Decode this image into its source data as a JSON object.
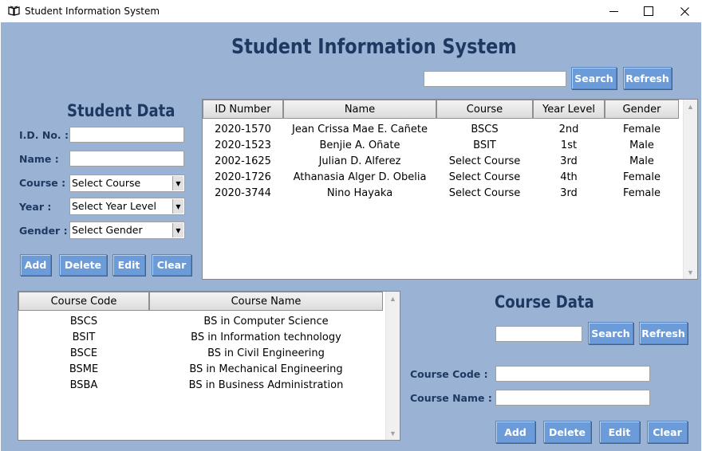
{
  "window": {
    "title": "Student Information System",
    "icon": "book-icon",
    "controls": {
      "minimize": "—",
      "maximize": "☐",
      "close": "✕"
    }
  },
  "header": {
    "title": "Student  Information  System"
  },
  "top_search": {
    "value": "",
    "search_label": "Search",
    "refresh_label": "Refresh"
  },
  "student_form": {
    "heading": "Student Data",
    "id_label": "I.D. No. :",
    "name_label": "Name :",
    "course_label": "Course :",
    "year_label": "Year :",
    "gender_label": "Gender :",
    "id_value": "",
    "name_value": "",
    "course_value": "Select Course",
    "year_value": "Select Year Level",
    "gender_value": "Select Gender",
    "buttons": {
      "add": "Add",
      "delete": "Delete",
      "edit": "Edit",
      "clear": "Clear"
    }
  },
  "student_table": {
    "columns": [
      "ID Number",
      "Name",
      "Course",
      "Year Level",
      "Gender"
    ],
    "rows": [
      [
        "2020-1570",
        "Jean Crissa Mae E. Cañete",
        "BSCS",
        "2nd",
        "Female"
      ],
      [
        "2020-1523",
        "Benjie A. Oñate",
        "BSIT",
        "1st",
        "Male"
      ],
      [
        "2002-1625",
        "Julian D. Alferez",
        "Select Course",
        "3rd",
        "Male"
      ],
      [
        "2020-1726",
        "Athanasia Alger D. Obelia",
        "Select Course",
        "4th",
        "Female"
      ],
      [
        "2020-3744",
        "Nino Hayaka",
        "Select Course",
        "3rd",
        "Female"
      ]
    ]
  },
  "course_table": {
    "columns": [
      "Course Code",
      "Course Name"
    ],
    "rows": [
      [
        "BSCS",
        "BS in Computer Science"
      ],
      [
        "BSIT",
        "BS in Information technology"
      ],
      [
        "BSCE",
        "BS in Civil Engineering"
      ],
      [
        "BSME",
        "BS in Mechanical Engineering"
      ],
      [
        "BSBA",
        "BS in Business Administration"
      ]
    ]
  },
  "course_form": {
    "heading": "Course Data",
    "search_value": "",
    "search_label": "Search",
    "refresh_label": "Refresh",
    "code_label": "Course Code :",
    "name_label": "Course Name :",
    "code_value": "",
    "name_value": "",
    "buttons": {
      "add": "Add",
      "delete": "Delete",
      "edit": "Edit",
      "clear": "Clear"
    }
  },
  "colors": {
    "background": "#9ab2d3",
    "heading": "#1f3862",
    "button": "#6b9bd8"
  }
}
